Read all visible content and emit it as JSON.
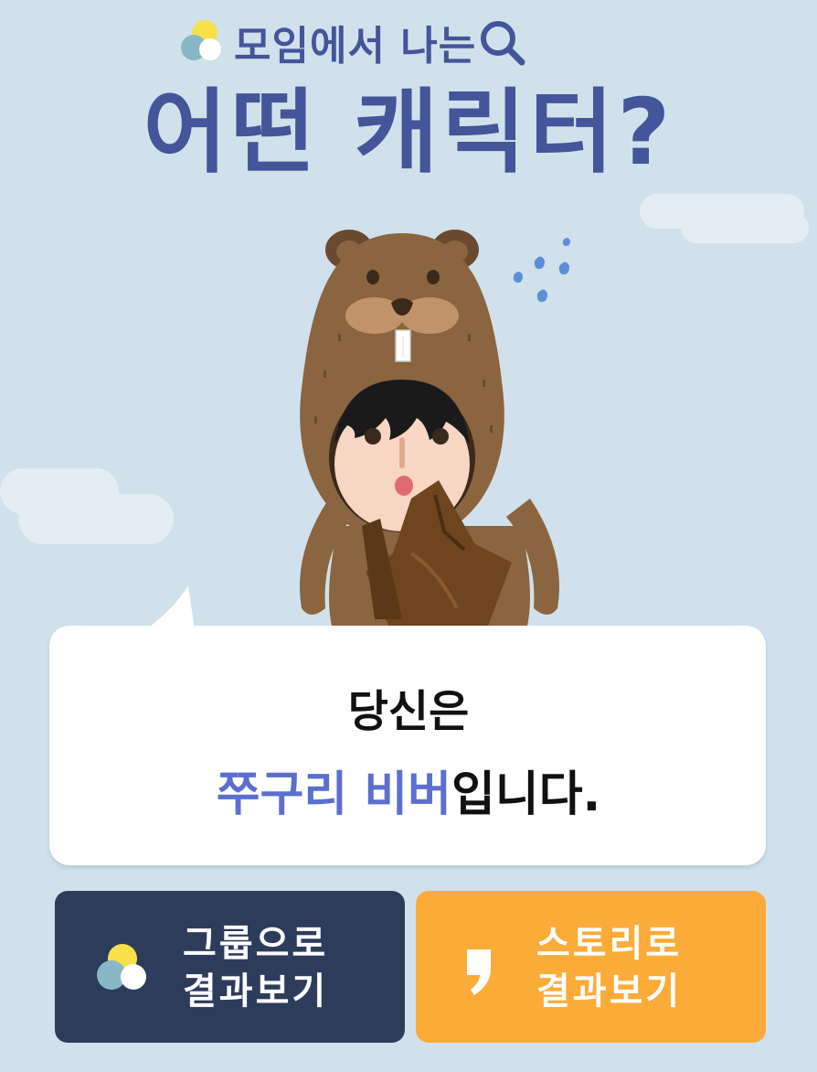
{
  "header": {
    "subtitle": "모임에서 나는",
    "title": "어떤 캐릭터?"
  },
  "result": {
    "line1": "당신은",
    "character_name": "쭈구리 비버",
    "suffix": "입니다."
  },
  "buttons": {
    "group": {
      "line1": "그룹으로",
      "line2": "결과보기",
      "icon": "circles-logo-icon"
    },
    "story": {
      "line1": "스토리로",
      "line2": "결과보기",
      "icon": "comma-icon"
    }
  },
  "colors": {
    "background": "#d0e1eb",
    "title": "#44559a",
    "highlight": "#5c6fd0",
    "group_button": "#2e3c5c",
    "story_button": "#fbab37"
  }
}
